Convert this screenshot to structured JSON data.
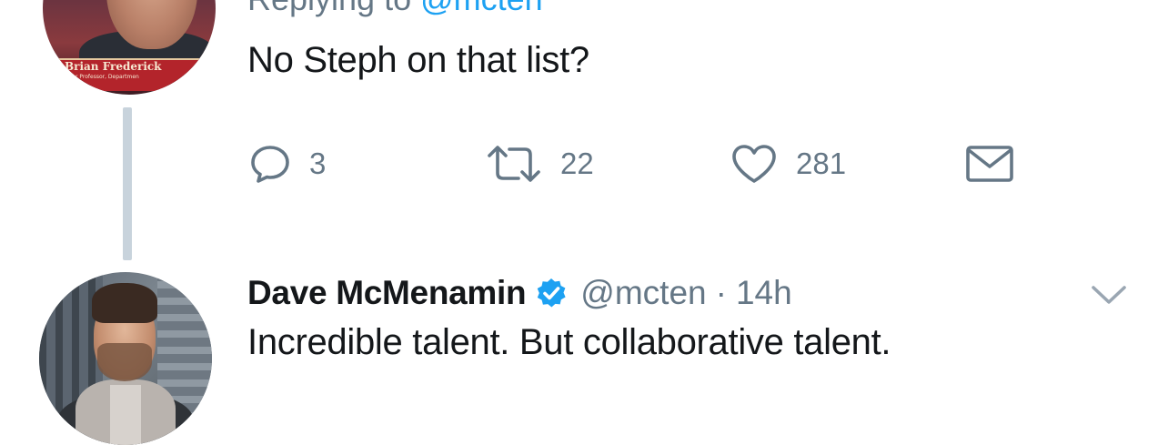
{
  "colors": {
    "text_primary": "#14171a",
    "text_secondary": "#657786",
    "link_blue": "#1da1f2",
    "thread_line": "#c8d3dc",
    "verified_blue": "#1da1f2"
  },
  "tweet_1": {
    "avatar_overlay": {
      "name": "Brian Frederick",
      "subtitle": "r Professor, Departmen"
    },
    "replying_prefix": "Replying to ",
    "replying_handle": "@mcten",
    "text": "No Steph on that list?",
    "actions": {
      "reply_count": "3",
      "retweet_count": "22",
      "like_count": "281",
      "icons": [
        "reply-icon",
        "retweet-icon",
        "heart-icon",
        "envelope-icon"
      ]
    }
  },
  "tweet_2": {
    "author_name": "Dave McMenamin",
    "verified": true,
    "handle": "@mcten",
    "separator": "·",
    "timestamp": "14h",
    "text": "Incredible talent. But collaborative talent.",
    "icons": [
      "verified-badge-icon",
      "chevron-down-icon"
    ]
  }
}
